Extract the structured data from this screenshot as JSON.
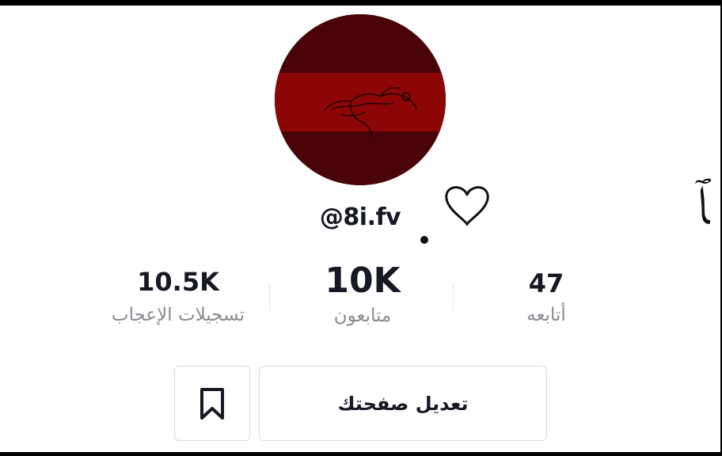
{
  "profile": {
    "avatar_icon": "avatar-image",
    "username": "@8i.fv",
    "display_name": "حلمي ﭑ ♡.",
    "display_name_parts": {
      "text": "حلمي ﭑ",
      "heart": "♡",
      "dot": "."
    }
  },
  "stats": {
    "likes": {
      "value": "10.5K",
      "label": "تسجيلات الإعجاب"
    },
    "followers": {
      "value": "10K",
      "label": "متابعون"
    },
    "following": {
      "value": "47",
      "label": "أتابعه"
    }
  },
  "actions": {
    "edit_profile_label": "تعديل صفحتك",
    "bookmark_icon": "bookmark-icon"
  },
  "colors": {
    "avatar_dark": "#4a0409",
    "avatar_band": "#8c0606",
    "text_primary": "#161823",
    "text_secondary": "#8a8b91",
    "border": "#dcdcde"
  }
}
